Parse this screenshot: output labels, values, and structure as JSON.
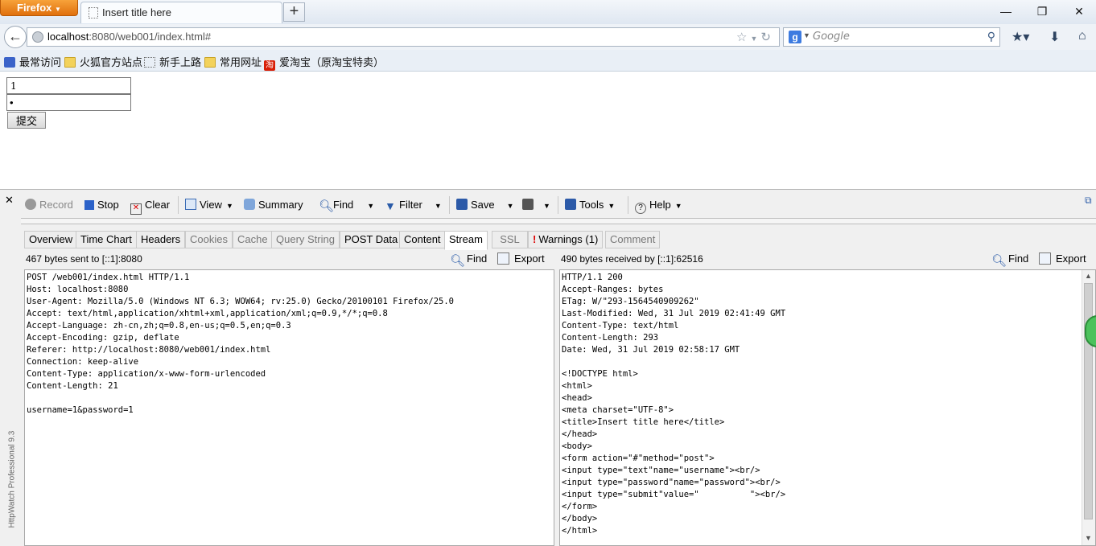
{
  "titlebar": {
    "app_button": "Firefox",
    "tab_title": "Insert title here",
    "new_tab_symbol": "+",
    "minimize_symbol": "—",
    "restore_symbol": "❐",
    "close_symbol": "✕"
  },
  "navbar": {
    "url_host": "localhost",
    "url_rest": ":8080/web001/index.html#",
    "search_placeholder": "Google"
  },
  "bookmarks": [
    {
      "label": "最常访问",
      "icon": "gear-icon"
    },
    {
      "label": "火狐官方站点",
      "icon": "folder-icon"
    },
    {
      "label": "新手上路",
      "icon": "page-icon"
    },
    {
      "label": "常用网址",
      "icon": "folder-icon"
    },
    {
      "label": "爱淘宝（原淘宝特卖）",
      "icon": "taobao-icon"
    }
  ],
  "form": {
    "username_value": "1",
    "password_value": "1",
    "submit_label": "提交"
  },
  "httpwatch": {
    "brand": "HttpWatch Professional 9.3",
    "toolbar": {
      "record": "Record",
      "stop": "Stop",
      "clear": "Clear",
      "view": "View",
      "summary": "Summary",
      "find": "Find",
      "filter": "Filter",
      "save": "Save",
      "tools": "Tools",
      "help": "Help"
    },
    "tabs": [
      "Overview",
      "Time Chart",
      "Headers",
      "Cookies",
      "Cache",
      "Query String",
      "POST Data",
      "Content",
      "Stream",
      "SSL",
      "Warnings (1)",
      "Comment"
    ],
    "active_tab": "Stream",
    "left_info": "467 bytes sent to [::1]:8080",
    "right_info": "490 bytes received by [::1]:62516",
    "find_label": "Find",
    "export_label": "Export",
    "request_text": "POST /web001/index.html HTTP/1.1\nHost: localhost:8080\nUser-Agent: Mozilla/5.0 (Windows NT 6.3; WOW64; rv:25.0) Gecko/20100101 Firefox/25.0\nAccept: text/html,application/xhtml+xml,application/xml;q=0.9,*/*;q=0.8\nAccept-Language: zh-cn,zh;q=0.8,en-us;q=0.5,en;q=0.3\nAccept-Encoding: gzip, deflate\nReferer: http://localhost:8080/web001/index.html\nConnection: keep-alive\nContent-Type: application/x-www-form-urlencoded\nContent-Length: 21\n\nusername=1&password=1",
    "response_text": "HTTP/1.1 200\nAccept-Ranges: bytes\nETag: W/\"293-1564540909262\"\nLast-Modified: Wed, 31 Jul 2019 02:41:49 GMT\nContent-Type: text/html\nContent-Length: 293\nDate: Wed, 31 Jul 2019 02:58:17 GMT\n\n<!DOCTYPE html>\n<html>\n<head>\n<meta charset=\"UTF-8\">\n<title>Insert title here</title>\n</head>\n<body>\n<form action=\"#\"method=\"post\">\n<input type=\"text\"name=\"username\"><br/>\n<input type=\"password\"name=\"password\"><br/>\n<input type=\"submit\"value=\"          \"><br/>\n</form>\n</body>\n</html>"
  }
}
